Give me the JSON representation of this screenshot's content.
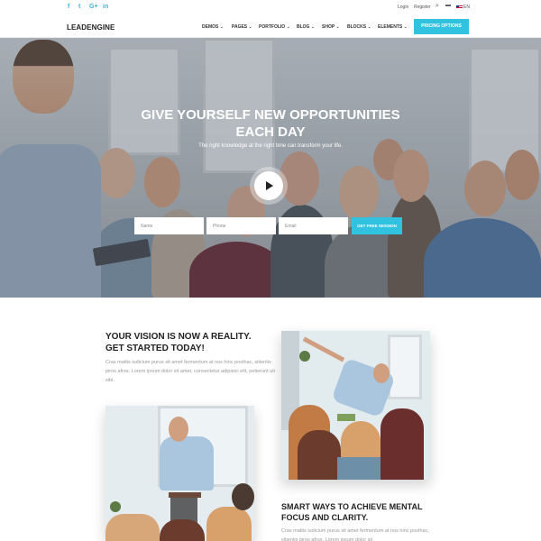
{
  "topbar": {
    "social": [
      {
        "icon": "facebook-icon",
        "glyph": "f"
      },
      {
        "icon": "twitter-icon",
        "glyph": "t"
      },
      {
        "icon": "google-plus-icon",
        "glyph": "G+"
      },
      {
        "icon": "linkedin-icon",
        "glyph": "in"
      }
    ],
    "login": "Login",
    "register": "Register",
    "language": "EN"
  },
  "nav": {
    "logo": "LEADENGINE",
    "items": [
      "DEMOS",
      "PAGES",
      "PORTFOLIO",
      "BLOG",
      "SHOP",
      "BLOCKS",
      "ELEMENTS"
    ],
    "caret": "⌄",
    "cta": "PRICING OPTIONS"
  },
  "hero": {
    "title_line1": "GIVE YOURSELF NEW OPPORTUNITIES",
    "title_line2": "EACH DAY",
    "subtitle": "The right knowledge at the right time can transform your life.",
    "form": {
      "name_placeholder": "Name",
      "phone_placeholder": "Phone",
      "email_placeholder": "Email",
      "button": "GET FREE SESSION"
    }
  },
  "section1": {
    "title_line1": "YOUR VISION IS NOW A REALITY.",
    "title_line2": "GET STARTED TODAY!",
    "text": "Cras mattis iudicium purus sit amet fermentum at nos hinc posthac, sitientis piros afros. Lorem ipsum dolor sit amet, consectetur adipisici elit, petierunt uti sibi."
  },
  "section2": {
    "title_line1": "SMART WAYS TO ACHIEVE MENTAL",
    "title_line2": "FOCUS AND CLARITY.",
    "text": "Cras mattis iudicium purus sit amet fermentum at nos hinc posthac, sitientis piros afros. Lorem ipsum dolor sit"
  },
  "colors": {
    "accent": "#31c2e0",
    "heading": "#222222",
    "body_text": "#999999"
  }
}
